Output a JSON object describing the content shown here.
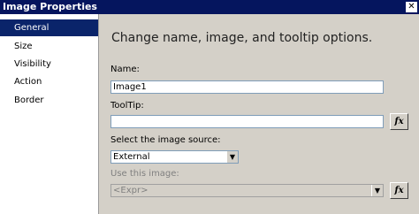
{
  "window": {
    "title": "Image Properties",
    "close_glyph": "✕"
  },
  "sidebar": {
    "items": [
      {
        "label": "General",
        "selected": true
      },
      {
        "label": "Size",
        "selected": false
      },
      {
        "label": "Visibility",
        "selected": false
      },
      {
        "label": "Action",
        "selected": false
      },
      {
        "label": "Border",
        "selected": false
      }
    ]
  },
  "main": {
    "header": "Change name, image, and tooltip options.",
    "name_label": "Name:",
    "name_value": "Image1",
    "tooltip_label": "ToolTip:",
    "tooltip_value": "",
    "source_label": "Select the image source:",
    "source_value": "External",
    "use_image_label": "Use this image:",
    "use_image_placeholder": "<Expr>",
    "fx_label": "fx"
  },
  "colors": {
    "titlebar": "#05155e",
    "selected": "#0a246a",
    "background": "#d4d0c8"
  }
}
